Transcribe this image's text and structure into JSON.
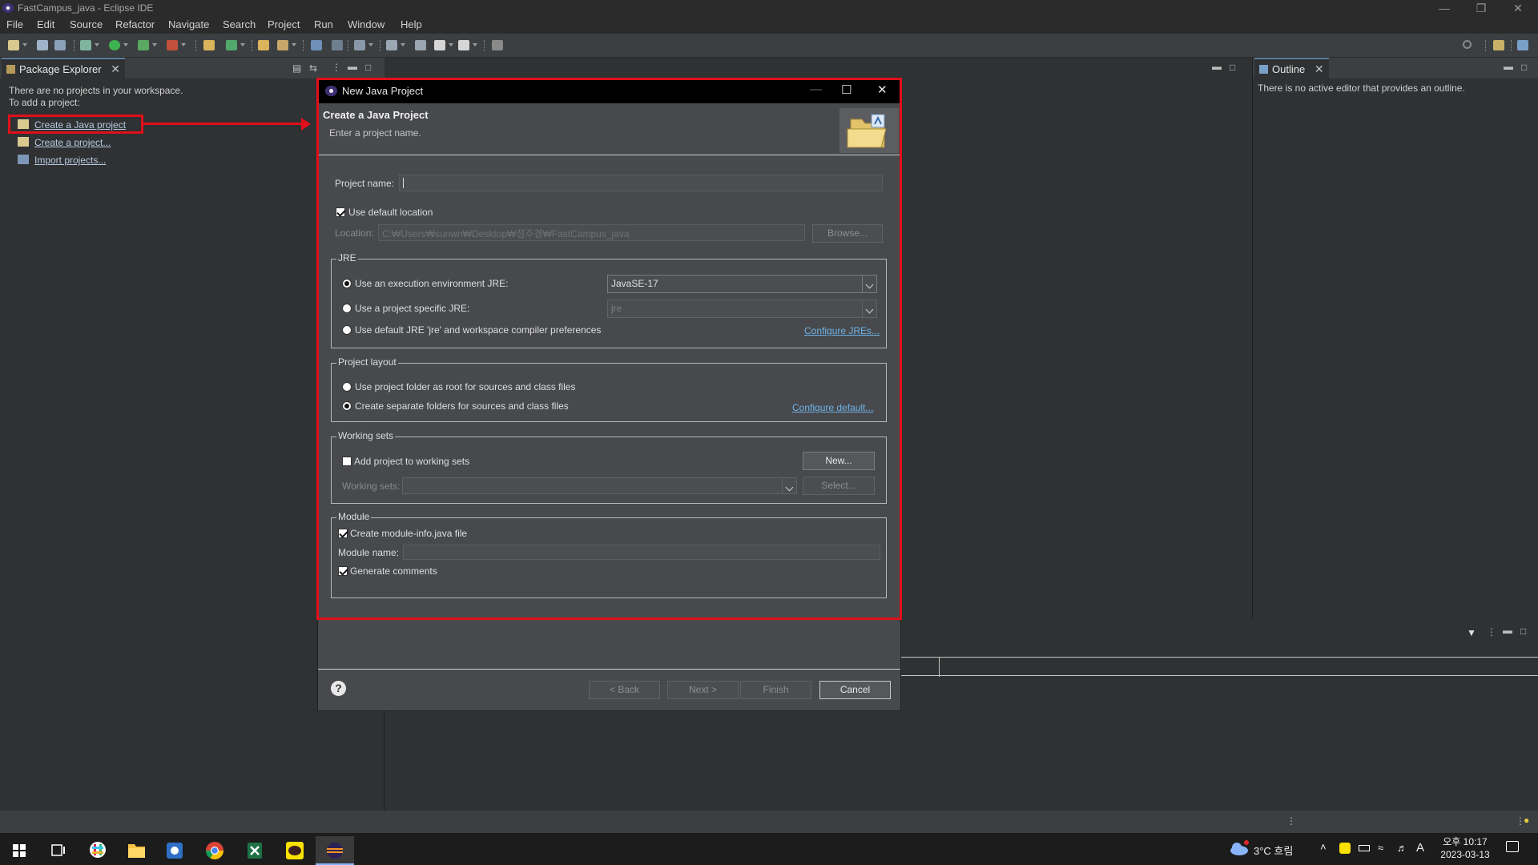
{
  "window": {
    "title": "FastCampus_java - Eclipse IDE"
  },
  "menubar": [
    "File",
    "Edit",
    "Source",
    "Refactor",
    "Navigate",
    "Search",
    "Project",
    "Run",
    "Window",
    "Help"
  ],
  "package_explorer": {
    "tab_label": "Package Explorer",
    "empty_line1": "There are no projects in your workspace.",
    "empty_line2": "To add a project:",
    "links": [
      "Create a Java project",
      "Create a project...",
      "Import projects..."
    ]
  },
  "outline": {
    "tab_label": "Outline",
    "empty_text": "There is no active editor that provides an outline."
  },
  "dialog": {
    "title": "New Java Project",
    "header_title": "Create a Java Project",
    "header_subtitle": "Enter a project name.",
    "project_name_label": "Project name:",
    "project_name_value": "",
    "use_default_location_label": "Use default location",
    "use_default_location_checked": true,
    "location_label": "Location:",
    "location_value": "C:₩Users₩sunwn₩Desktop₩정주경₩FastCampus_java",
    "browse_label": "Browse...",
    "jre": {
      "group_label": "JRE",
      "option_execution_env": "Use an execution environment JRE:",
      "execution_env_value": "JavaSE-17",
      "option_project_specific": "Use a project specific JRE:",
      "project_specific_value": "jre",
      "option_default": "Use default JRE 'jre' and workspace compiler preferences",
      "configure_link": "Configure JREs..."
    },
    "layout": {
      "group_label": "Project layout",
      "option_root": "Use project folder as root for sources and class files",
      "option_separate": "Create separate folders for sources and class files",
      "configure_link": "Configure default..."
    },
    "working_sets": {
      "group_label": "Working sets",
      "add_label": "Add project to working sets",
      "new_label": "New...",
      "sets_label": "Working sets:",
      "select_label": "Select..."
    },
    "module": {
      "group_label": "Module",
      "create_label": "Create module-info.java file",
      "name_label": "Module name:",
      "generate_label": "Generate comments"
    },
    "footer": {
      "help_glyph": "?",
      "back_label": "< Back",
      "next_label": "Next >",
      "finish_label": "Finish",
      "cancel_label": "Cancel"
    }
  },
  "taskbar": {
    "weather": "3°C  흐림",
    "ime": "A",
    "time": "오후 10:17",
    "date": "2023-03-13"
  },
  "colors": {
    "highlight_red": "#e0101a",
    "link_blue": "#6fb3e8",
    "dialog_bg": "#47494c",
    "ide_bg": "#2f3133"
  }
}
